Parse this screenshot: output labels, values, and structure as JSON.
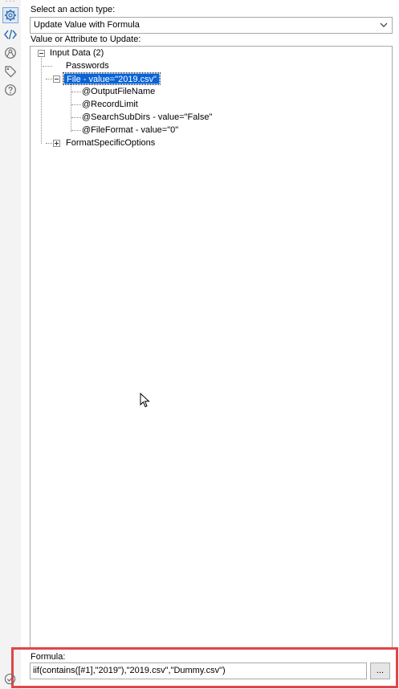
{
  "rail": {
    "overflow": "···",
    "icons": [
      "gear-icon",
      "code-icon",
      "connections-icon",
      "tag-icon",
      "help-icon"
    ]
  },
  "action": {
    "label": "Select an action type:",
    "selected": "Update Value with Formula"
  },
  "tree": {
    "label": "Value or Attribute to Update:",
    "nodes": {
      "root": "Input Data (2)",
      "passwords": "Passwords",
      "file": "File - value=\"2019.csv\"",
      "output_file_name": "@OutputFileName",
      "record_limit": "@RecordLimit",
      "search_sub_dirs": "@SearchSubDirs - value=\"False\"",
      "file_format": "@FileFormat - value=\"0\"",
      "format_specific": "FormatSpecificOptions"
    }
  },
  "formula": {
    "label": "Formula:",
    "value": "iif(contains([#1],\"2019\"),\"2019.csv\",\"Dummy.csv\")",
    "button": "..."
  },
  "colors": {
    "selection": "#0a64d6",
    "highlight_border": "#e0454a",
    "rail_bg": "#f3f3f3"
  }
}
